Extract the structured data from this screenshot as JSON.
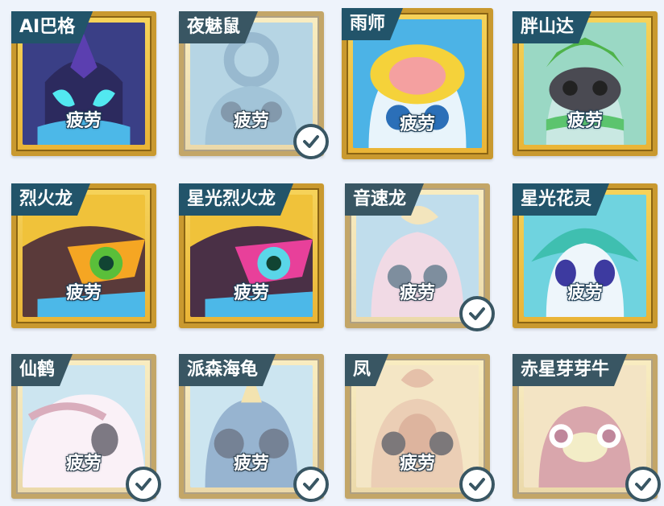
{
  "cards": [
    {
      "name": "AI巴格",
      "status": "疲劳",
      "selected": false,
      "icon": "dark-dragon-icon"
    },
    {
      "name": "夜魅鼠",
      "status": "疲劳",
      "selected": true,
      "icon": "blue-mouse-icon"
    },
    {
      "name": "雨师",
      "status": "疲劳",
      "selected": false,
      "icon": "rain-creature-icon"
    },
    {
      "name": "胖山达",
      "status": "疲劳",
      "selected": false,
      "icon": "leaf-panda-icon"
    },
    {
      "name": "烈火龙",
      "status": "疲劳",
      "selected": false,
      "icon": "fire-dragon-icon"
    },
    {
      "name": "星光烈火龙",
      "status": "疲劳",
      "selected": false,
      "icon": "star-fire-dragon-icon"
    },
    {
      "name": "音速龙",
      "status": "疲劳",
      "selected": true,
      "icon": "sonic-dragon-icon"
    },
    {
      "name": "星光花灵",
      "status": "疲劳",
      "selected": false,
      "icon": "flower-spirit-icon"
    },
    {
      "name": "仙鹤",
      "status": "疲劳",
      "selected": true,
      "icon": "crane-icon"
    },
    {
      "name": "派森海龟",
      "status": "疲劳",
      "selected": true,
      "icon": "sea-turtle-icon"
    },
    {
      "name": "凤",
      "status": "疲劳",
      "selected": true,
      "icon": "phoenix-icon"
    },
    {
      "name": "赤星芽芽牛",
      "status": "",
      "selected": true,
      "icon": "sprout-cow-icon"
    }
  ],
  "colors": {
    "frame": "#c9992f",
    "tag": "#22546a",
    "check": "#22546a"
  }
}
